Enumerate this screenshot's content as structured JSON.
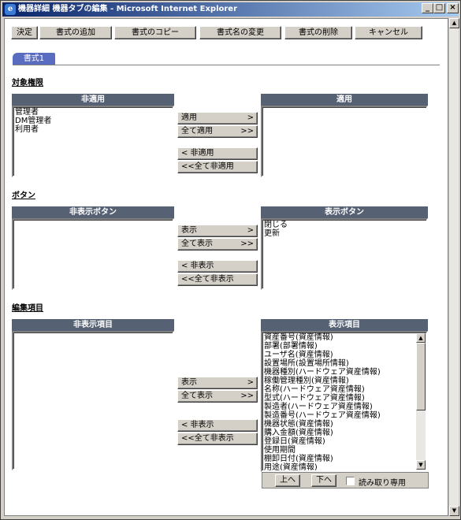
{
  "window": {
    "title": "機器詳細 機器タブの編集 - Microsoft Internet Explorer",
    "icon": "ie-icon",
    "controls": {
      "minimize": "_",
      "maximize": "□",
      "close": "×"
    }
  },
  "toolbar": {
    "ok": "決定",
    "add_format": "書式の追加",
    "copy_format": "書式のコピー",
    "rename_format": "書式名の変更",
    "delete_format": "書式の削除",
    "cancel": "キャンセル"
  },
  "tab": {
    "label": "書式1"
  },
  "sections": {
    "permissions": {
      "title": "対象権限",
      "left_header": "非適用",
      "right_header": "適用",
      "left_items": [
        "管理者",
        "DM管理者",
        "利用者"
      ],
      "right_items": [],
      "buttons": {
        "apply": "適用",
        "apply_arrow": ">",
        "apply_all": "全て適用",
        "apply_all_arrow": ">>",
        "unapply": "< 非適用",
        "unapply_all": "<<全て非適用"
      }
    },
    "buttons": {
      "title": "ボタン",
      "left_header": "非表示ボタン",
      "right_header": "表示ボタン",
      "left_items": [],
      "right_items": [
        "閉じる",
        "更新"
      ],
      "buttons": {
        "show": "表示",
        "show_arrow": ">",
        "show_all": "全て表示",
        "show_all_arrow": ">>",
        "hide": "< 非表示",
        "hide_all": "<<全て非表示"
      }
    },
    "fields": {
      "title": "編集項目",
      "left_header": "非表示項目",
      "right_header": "表示項目",
      "left_items": [],
      "right_items": [
        "資産番号(資産情報)",
        "部署(部署情報)",
        "ユーザ名(資産情報)",
        "設置場所(設置場所情報)",
        "機器種別(ハードウェア資産情報)",
        "稼働管理種別(資産情報)",
        "名称(ハードウェア資産情報)",
        "型式(ハードウェア資産情報)",
        "製造者(ハードウェア資産情報)",
        "製造番号(ハードウェア資産情報)",
        "機器状態(資産情報)",
        "購入金額(資産情報)",
        "登録日(資産情報)",
        "使用期間",
        "棚卸日付(資産情報)",
        "用途(資産情報)"
      ],
      "buttons": {
        "show": "表示",
        "show_arrow": ">",
        "show_all": "全て表示",
        "show_all_arrow": ">>",
        "hide": "< 非表示",
        "hide_all": "<<全て非表示"
      },
      "move_up": "上へ",
      "move_down": "下へ",
      "readonly_label": "読み取り専用"
    }
  }
}
